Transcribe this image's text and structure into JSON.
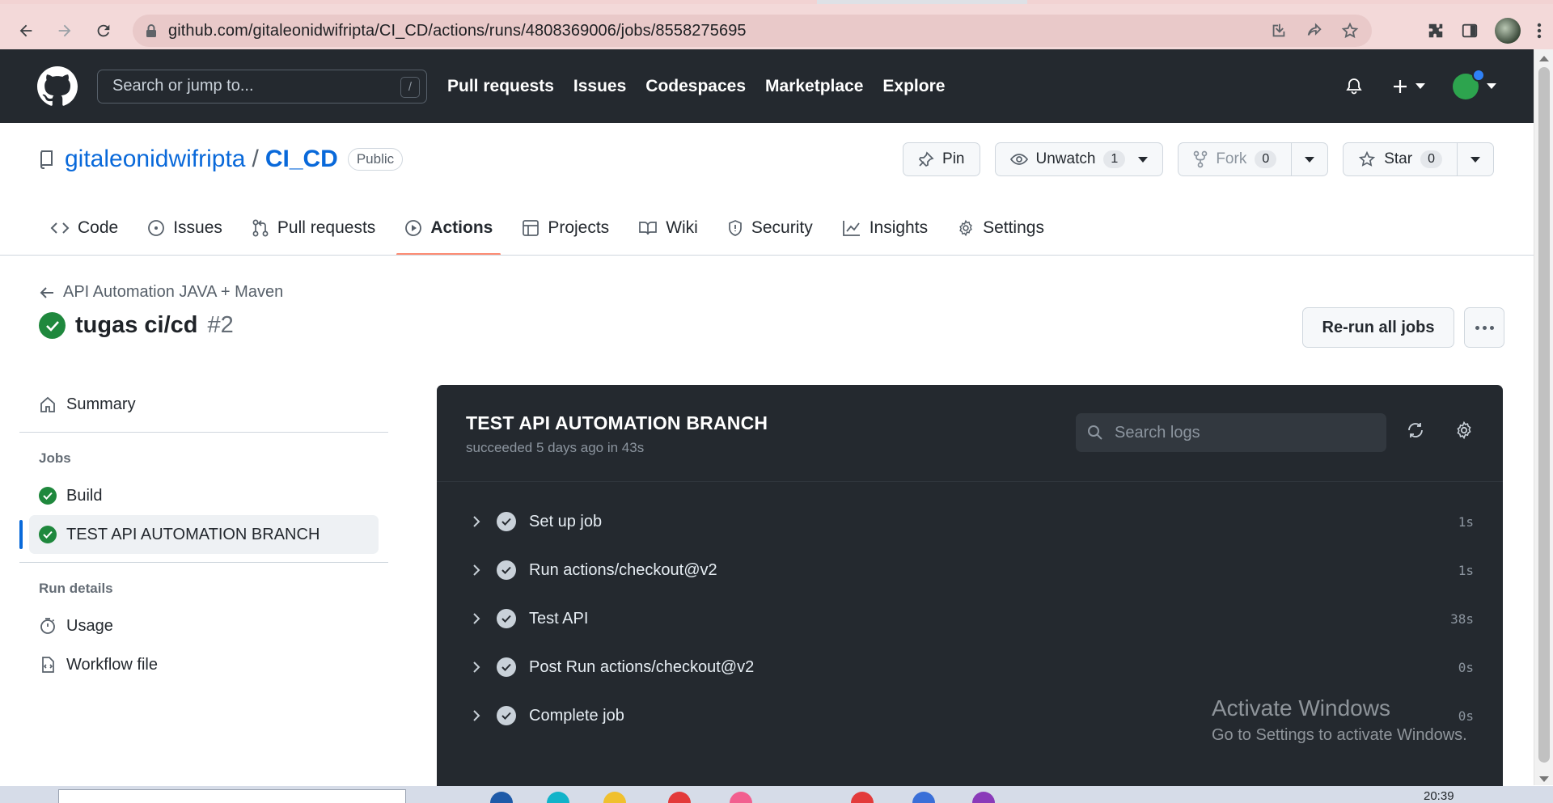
{
  "browser": {
    "url": "github.com/gitaleonidwifripta/CI_CD/actions/runs/4808369006/jobs/8558275695"
  },
  "header": {
    "search_placeholder": "Search or jump to...",
    "search_shortcut": "/",
    "nav": [
      "Pull requests",
      "Issues",
      "Codespaces",
      "Marketplace",
      "Explore"
    ]
  },
  "repo": {
    "owner": "gitaleonidwifripta",
    "separator": "/",
    "name": "CI_CD",
    "visibility": "Public",
    "pin_label": "Pin",
    "watch_label": "Unwatch",
    "watch_count": "1",
    "fork_label": "Fork",
    "fork_count": "0",
    "star_label": "Star",
    "star_count": "0"
  },
  "tabs": [
    {
      "label": "Code",
      "icon": "code-icon"
    },
    {
      "label": "Issues",
      "icon": "issue-icon"
    },
    {
      "label": "Pull requests",
      "icon": "pull-request-icon"
    },
    {
      "label": "Actions",
      "icon": "play-icon",
      "active": true
    },
    {
      "label": "Projects",
      "icon": "table-icon"
    },
    {
      "label": "Wiki",
      "icon": "book-icon"
    },
    {
      "label": "Security",
      "icon": "shield-icon"
    },
    {
      "label": "Insights",
      "icon": "graph-icon"
    },
    {
      "label": "Settings",
      "icon": "gear-icon"
    }
  ],
  "run": {
    "back_label": "API Automation JAVA + Maven",
    "title": "tugas ci/cd",
    "number": "#2",
    "rerun_label": "Re-run all jobs"
  },
  "sidebar": {
    "summary": "Summary",
    "jobs_heading": "Jobs",
    "jobs": [
      "Build",
      "TEST API AUTOMATION BRANCH"
    ],
    "run_details_heading": "Run details",
    "usage": "Usage",
    "workflow_file": "Workflow file"
  },
  "job": {
    "title": "TEST API AUTOMATION BRANCH",
    "subtitle": "succeeded 5 days ago in 43s",
    "search_placeholder": "Search logs",
    "steps": [
      {
        "label": "Set up job",
        "duration": "1s"
      },
      {
        "label": "Run actions/checkout@v2",
        "duration": "1s"
      },
      {
        "label": "Test API",
        "duration": "38s"
      },
      {
        "label": "Post Run actions/checkout@v2",
        "duration": "0s"
      },
      {
        "label": "Complete job",
        "duration": "0s"
      }
    ]
  },
  "watermark": {
    "line1": "Activate Windows",
    "line2": "Go to Settings to activate Windows."
  },
  "taskbar": {
    "clock": "20:39"
  },
  "colors": {
    "header_bg": "#24292f",
    "accent_link": "#0969da",
    "success": "#1f883d",
    "active_tab_underline": "#fd8c73",
    "job_panel_bg": "#24292f"
  }
}
